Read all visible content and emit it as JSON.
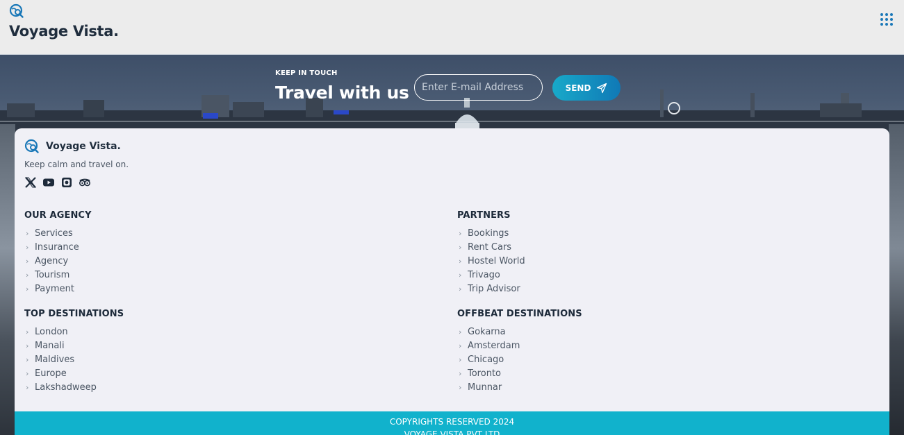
{
  "header": {
    "brand": "Voyage Vista.",
    "logo_icon": "search-globe-icon",
    "menu_icon": "grid-dots-icon"
  },
  "newsletter": {
    "kicker": "KEEP IN TOUCH",
    "title": "Travel with us",
    "email_placeholder": "Enter E-mail Address",
    "send_label": "SEND",
    "send_icon": "paper-plane-icon"
  },
  "footer_brand": {
    "name": "Voyage Vista.",
    "tagline": "Keep calm and travel on.",
    "socials": [
      "x-icon",
      "youtube-icon",
      "instagram-icon",
      "tripadvisor-icon"
    ]
  },
  "columns": {
    "our_agency": {
      "title": "OUR AGENCY",
      "items": [
        "Services",
        "Insurance",
        "Agency",
        "Tourism",
        "Payment"
      ]
    },
    "partners": {
      "title": "PARTNERS",
      "items": [
        "Bookings",
        "Rent Cars",
        "Hostel World",
        "Trivago",
        "Trip Advisor"
      ]
    },
    "top_destinations": {
      "title": "TOP DESTINATIONS",
      "items": [
        "London",
        "Manali",
        "Maldives",
        "Europe",
        "Lakshadweep"
      ]
    },
    "offbeat_destinations": {
      "title": "OFFBEAT DESTINATIONS",
      "items": [
        "Gokarna",
        "Amsterdam",
        "Chicago",
        "Toronto",
        "Munnar"
      ]
    }
  },
  "copyright": {
    "line1": "COPYRIGHTS RESERVED 2024",
    "line2": "VOYAGE VISTA PVT LTD"
  },
  "colors": {
    "accent": "#11b2cc",
    "brand_blue": "#1a78b8",
    "text_dark": "#1d2a3a"
  }
}
